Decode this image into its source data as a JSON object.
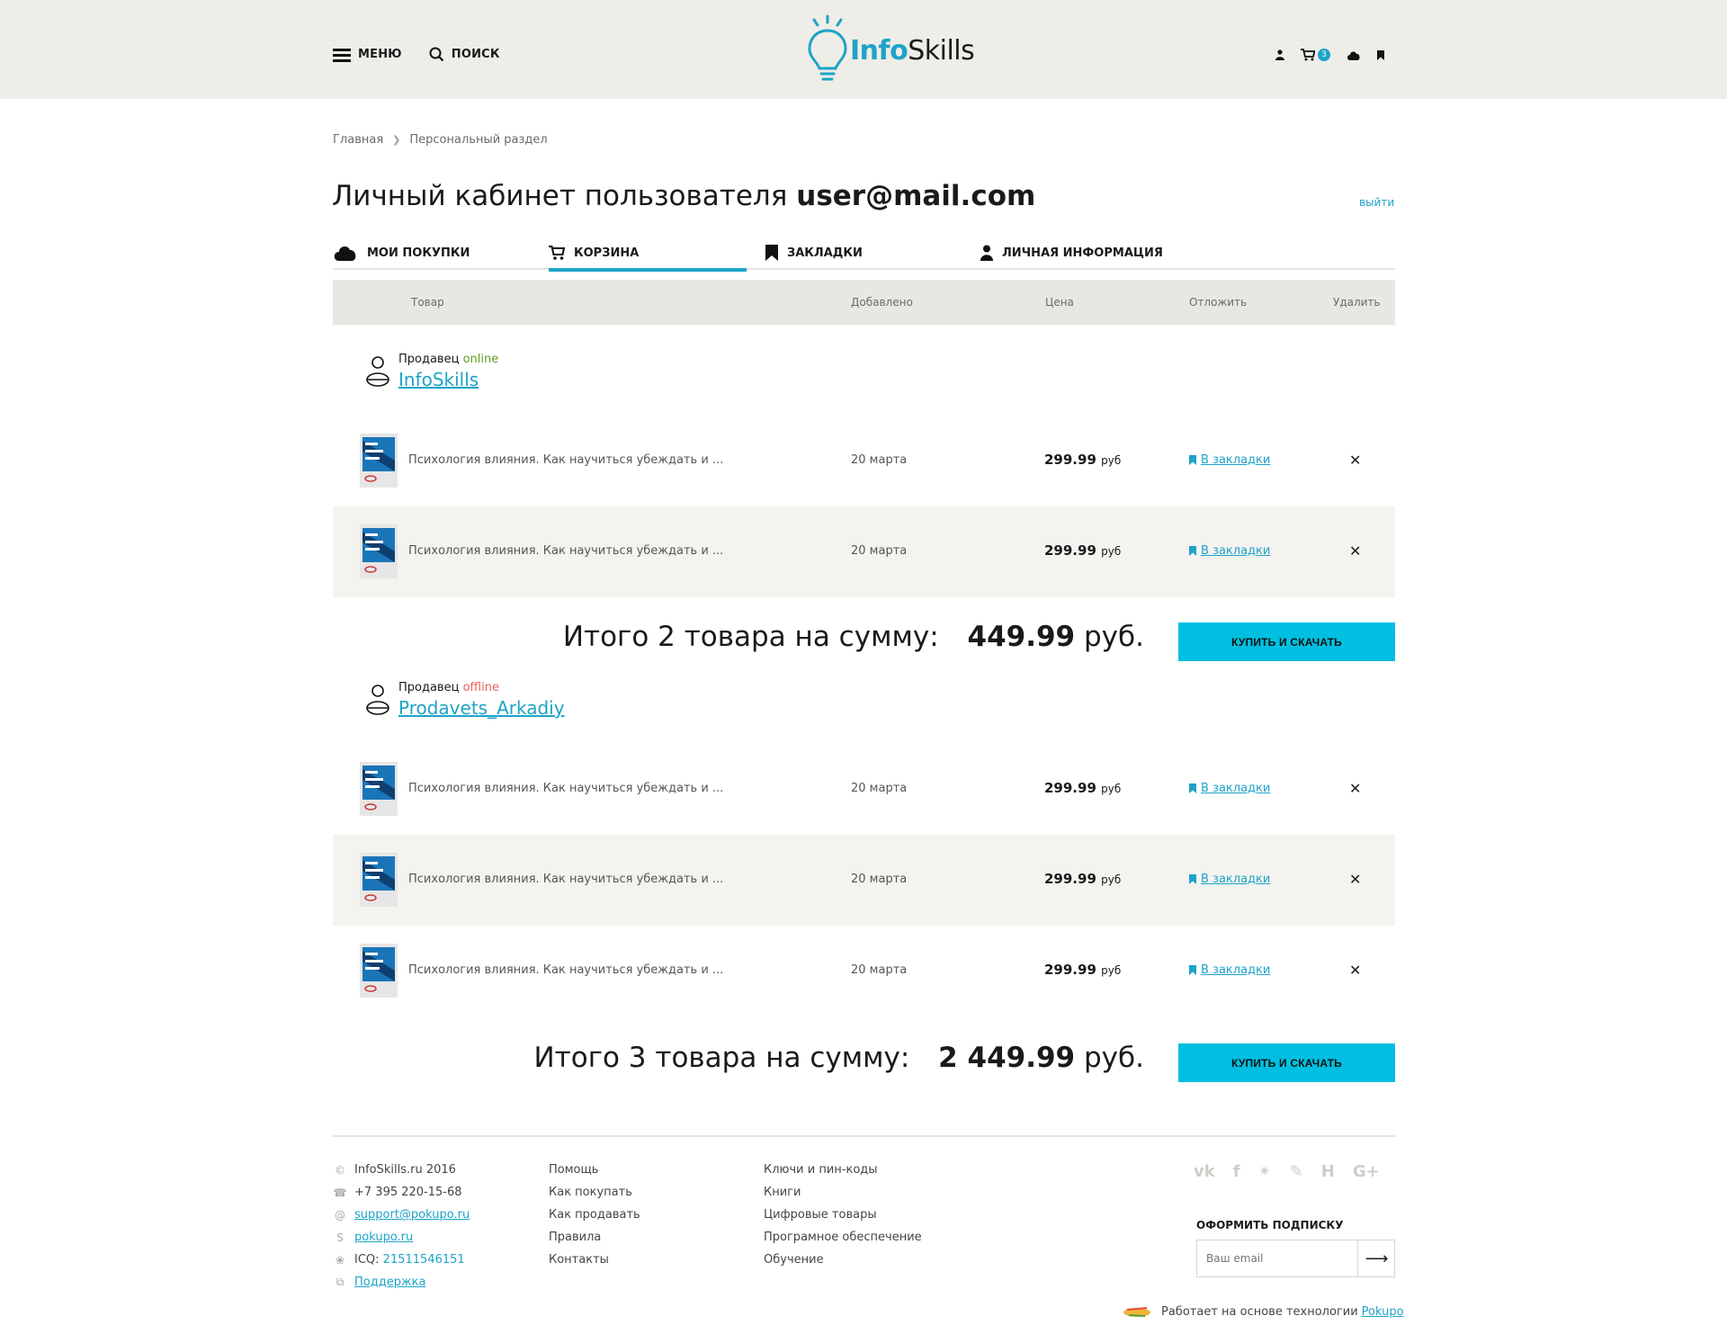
{
  "header": {
    "menu_label": "МЕНЮ",
    "search_label": "ПОИСК",
    "logo_part1": "Info",
    "logo_part2": "Skills",
    "cart_count": "3"
  },
  "breadcrumb": {
    "home": "Главная",
    "current": "Персональный раздел"
  },
  "page": {
    "title_prefix": "Личный кабинет пользователя",
    "user_email": "user@mail.com",
    "logout": "выйти"
  },
  "tabs": [
    {
      "label": "МОИ ПОКУПКИ"
    },
    {
      "label": "КОРЗИНА"
    },
    {
      "label": "ЗАКЛАДКИ"
    },
    {
      "label": "ЛИЧНАЯ ИНФОРМАЦИЯ"
    }
  ],
  "table_header": {
    "product": "Товар",
    "added": "Добавлено",
    "price": "Цена",
    "defer": "Отложить",
    "delete": "Удалить"
  },
  "sellers": [
    {
      "label": "Продавец",
      "status": "online",
      "name": "InfoSkills",
      "items": [
        {
          "title": "Психология влияния. Как научиться убеждать и ...",
          "date": "20 марта",
          "price": "299.99",
          "currency": "руб",
          "bookmark": "В закладки"
        },
        {
          "title": "Психология влияния. Как научиться убеждать и ...",
          "date": "20 марта",
          "price": "299.99",
          "currency": "руб",
          "bookmark": "В закладки"
        }
      ],
      "total_label": "Итого 2 товара на сумму:",
      "total_value": "449.99",
      "total_currency": "руб.",
      "buy_label": "КУПИТЬ И СКАЧАТЬ"
    },
    {
      "label": "Продавец",
      "status": "offline",
      "name": "Prodavets_Arkadiy",
      "items": [
        {
          "title": "Психология влияния. Как научиться убеждать и ...",
          "date": "20 марта",
          "price": "299.99",
          "currency": "руб",
          "bookmark": "В закладки"
        },
        {
          "title": "Психология влияния. Как научиться убеждать и ...",
          "date": "20 марта",
          "price": "299.99",
          "currency": "руб",
          "bookmark": "В закладки"
        },
        {
          "title": "Психология влияния. Как научиться убеждать и ...",
          "date": "20 марта",
          "price": "299.99",
          "currency": "руб",
          "bookmark": "В закладки"
        }
      ],
      "total_label": "Итого 3 товара на сумму:",
      "total_value": "2 449.99",
      "total_currency": "руб.",
      "buy_label": "КУПИТЬ И СКАЧАТЬ"
    }
  ],
  "footer": {
    "contacts": {
      "copyright": "InfoSkills.ru 2016",
      "phone": "+7 395 220-15-68",
      "email": "support@pokupo.ru",
      "skype": "pokupo.ru",
      "icq_label": "ICQ:",
      "icq": "21511546151",
      "support": "Поддержка"
    },
    "col2": [
      "Помощь",
      "Как покупать",
      "Как продавать",
      "Правила",
      "Контакты"
    ],
    "col3": [
      "Ключи и пин-коды",
      "Книги",
      "Цифровые товары",
      "Програмное обеспечение",
      "Обучение"
    ],
    "social": [
      "vk-icon",
      "facebook-icon",
      "twitter-icon",
      "livejournal-icon",
      "habr-icon",
      "google-plus-icon"
    ],
    "subscribe_title": "ОФОРМИТЬ ПОДПИСКУ",
    "subscribe_placeholder": "Ваш email",
    "powered_text": "Работает на основе технологии",
    "powered_link": "Pokupo"
  },
  "colors": {
    "accent": "#1ea3c8",
    "button": "#00bfe1",
    "header_bg": "#efede8",
    "online": "#5aa023",
    "offline": "#e8635a"
  }
}
